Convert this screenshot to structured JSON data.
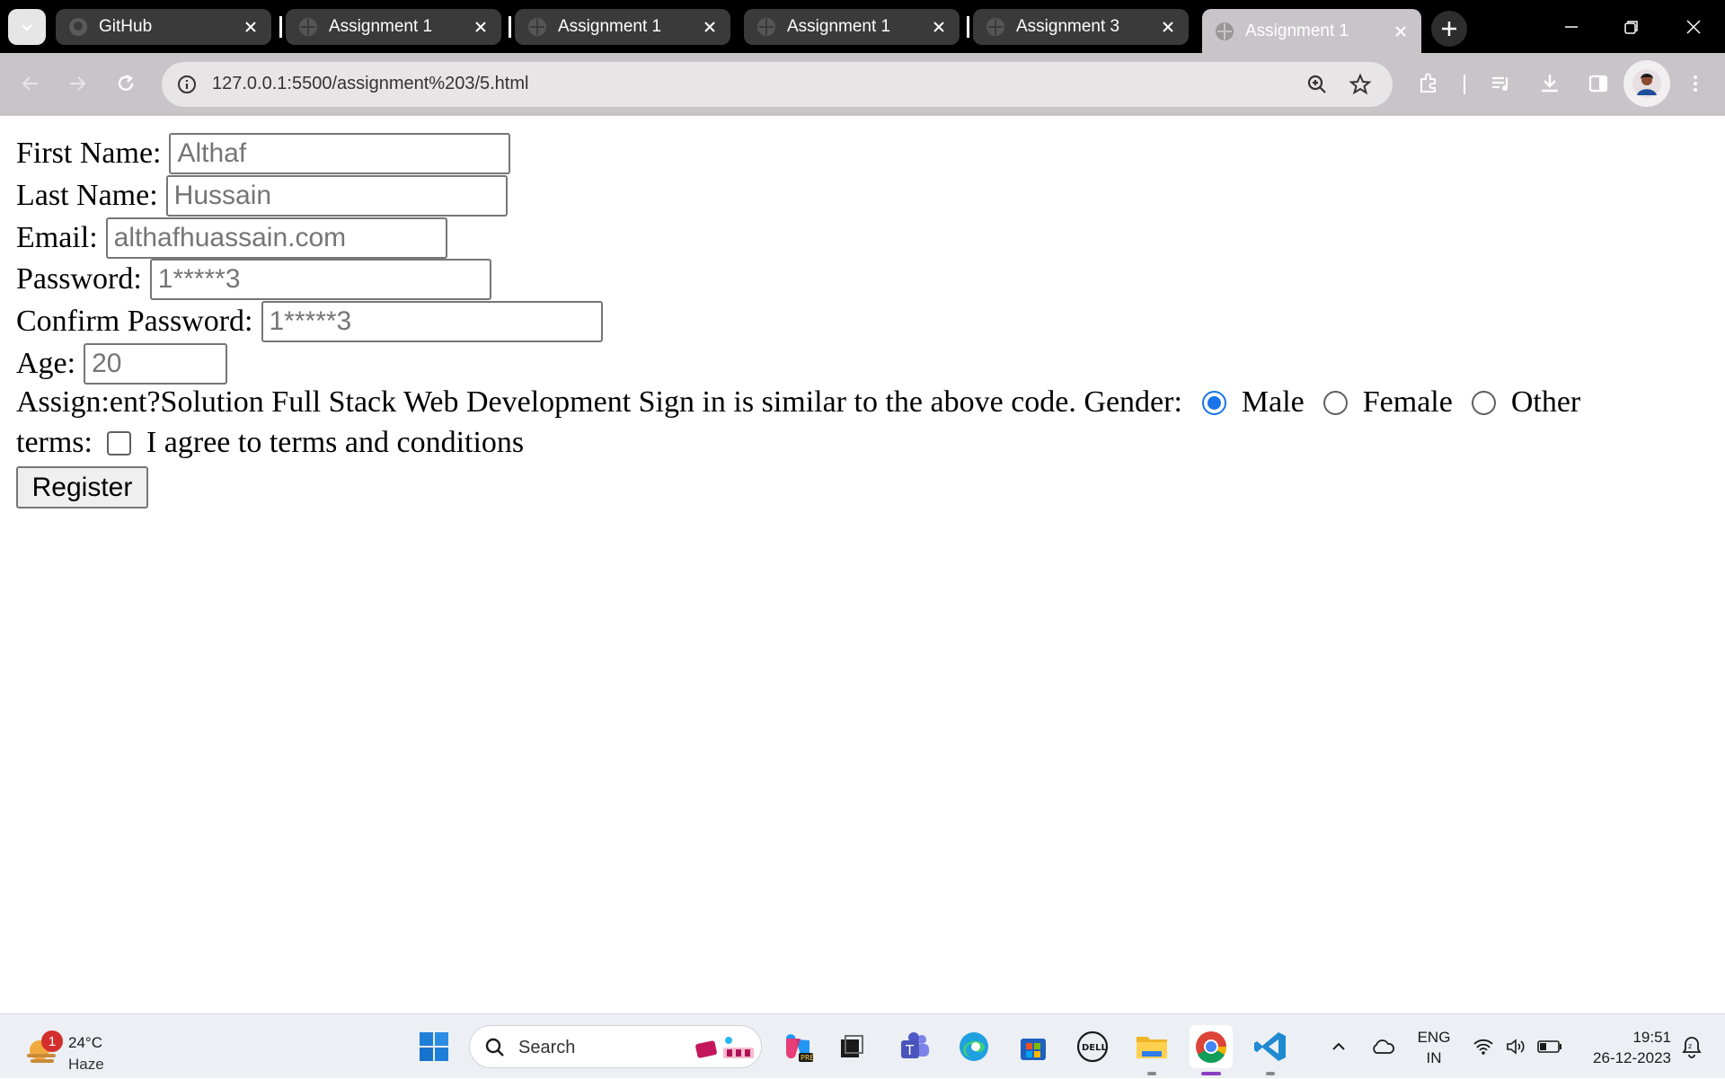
{
  "browser": {
    "tabs": [
      {
        "title": "GitHub",
        "favicon": "github-icon",
        "active": false
      },
      {
        "title": "Assignment 1",
        "favicon": "globe-icon",
        "active": false
      },
      {
        "title": "Assignment 1",
        "favicon": "globe-icon",
        "active": false
      },
      {
        "title": "Assignment 1",
        "favicon": "globe-icon",
        "active": false
      },
      {
        "title": "Assignment 3",
        "favicon": "globe-icon",
        "active": false
      },
      {
        "title": "Assignment 1",
        "favicon": "globe-icon",
        "active": true
      }
    ],
    "url": "127.0.0.1:5500/assignment%203/5.html",
    "colors": {
      "frame": "#000000",
      "toolbar": "#c9c4c7",
      "omnibox": "#e8e5e7"
    }
  },
  "form": {
    "first_name": {
      "label": "First Name:",
      "value": "Althaf"
    },
    "last_name": {
      "label": "Last Name:",
      "value": "Hussain"
    },
    "email": {
      "label": "Email:",
      "value": "althafhuassain.com"
    },
    "password": {
      "label": "Password:",
      "value": "1*****3"
    },
    "confirm_password": {
      "label": "Confirm Password:",
      "value": "1*****3"
    },
    "age": {
      "label": "Age:",
      "value": "20"
    },
    "gender_text": "Assign:ent?Solution Full Stack Web Development Sign in is similar to the above code. Gender:",
    "gender_options": [
      {
        "label": "Male",
        "checked": true
      },
      {
        "label": "Female",
        "checked": false
      },
      {
        "label": "Other",
        "checked": false
      }
    ],
    "terms_label": "terms:",
    "terms_text": "I agree to terms and conditions",
    "terms_checked": false,
    "register_label": "Register",
    "accent": "#1a73e8"
  },
  "taskbar": {
    "weather": {
      "temp": "24°C",
      "condition": "Haze",
      "badge": "1"
    },
    "search_label": "Search",
    "apps": [
      "windows-start-icon",
      "copilot-icon",
      "task-view-icon",
      "teams-icon",
      "edge-icon",
      "store-icon",
      "dell-icon",
      "file-explorer-icon",
      "chrome-icon",
      "vscode-icon"
    ],
    "language": {
      "line1": "ENG",
      "line2": "IN"
    },
    "time": "19:51",
    "date": "26-12-2023"
  }
}
